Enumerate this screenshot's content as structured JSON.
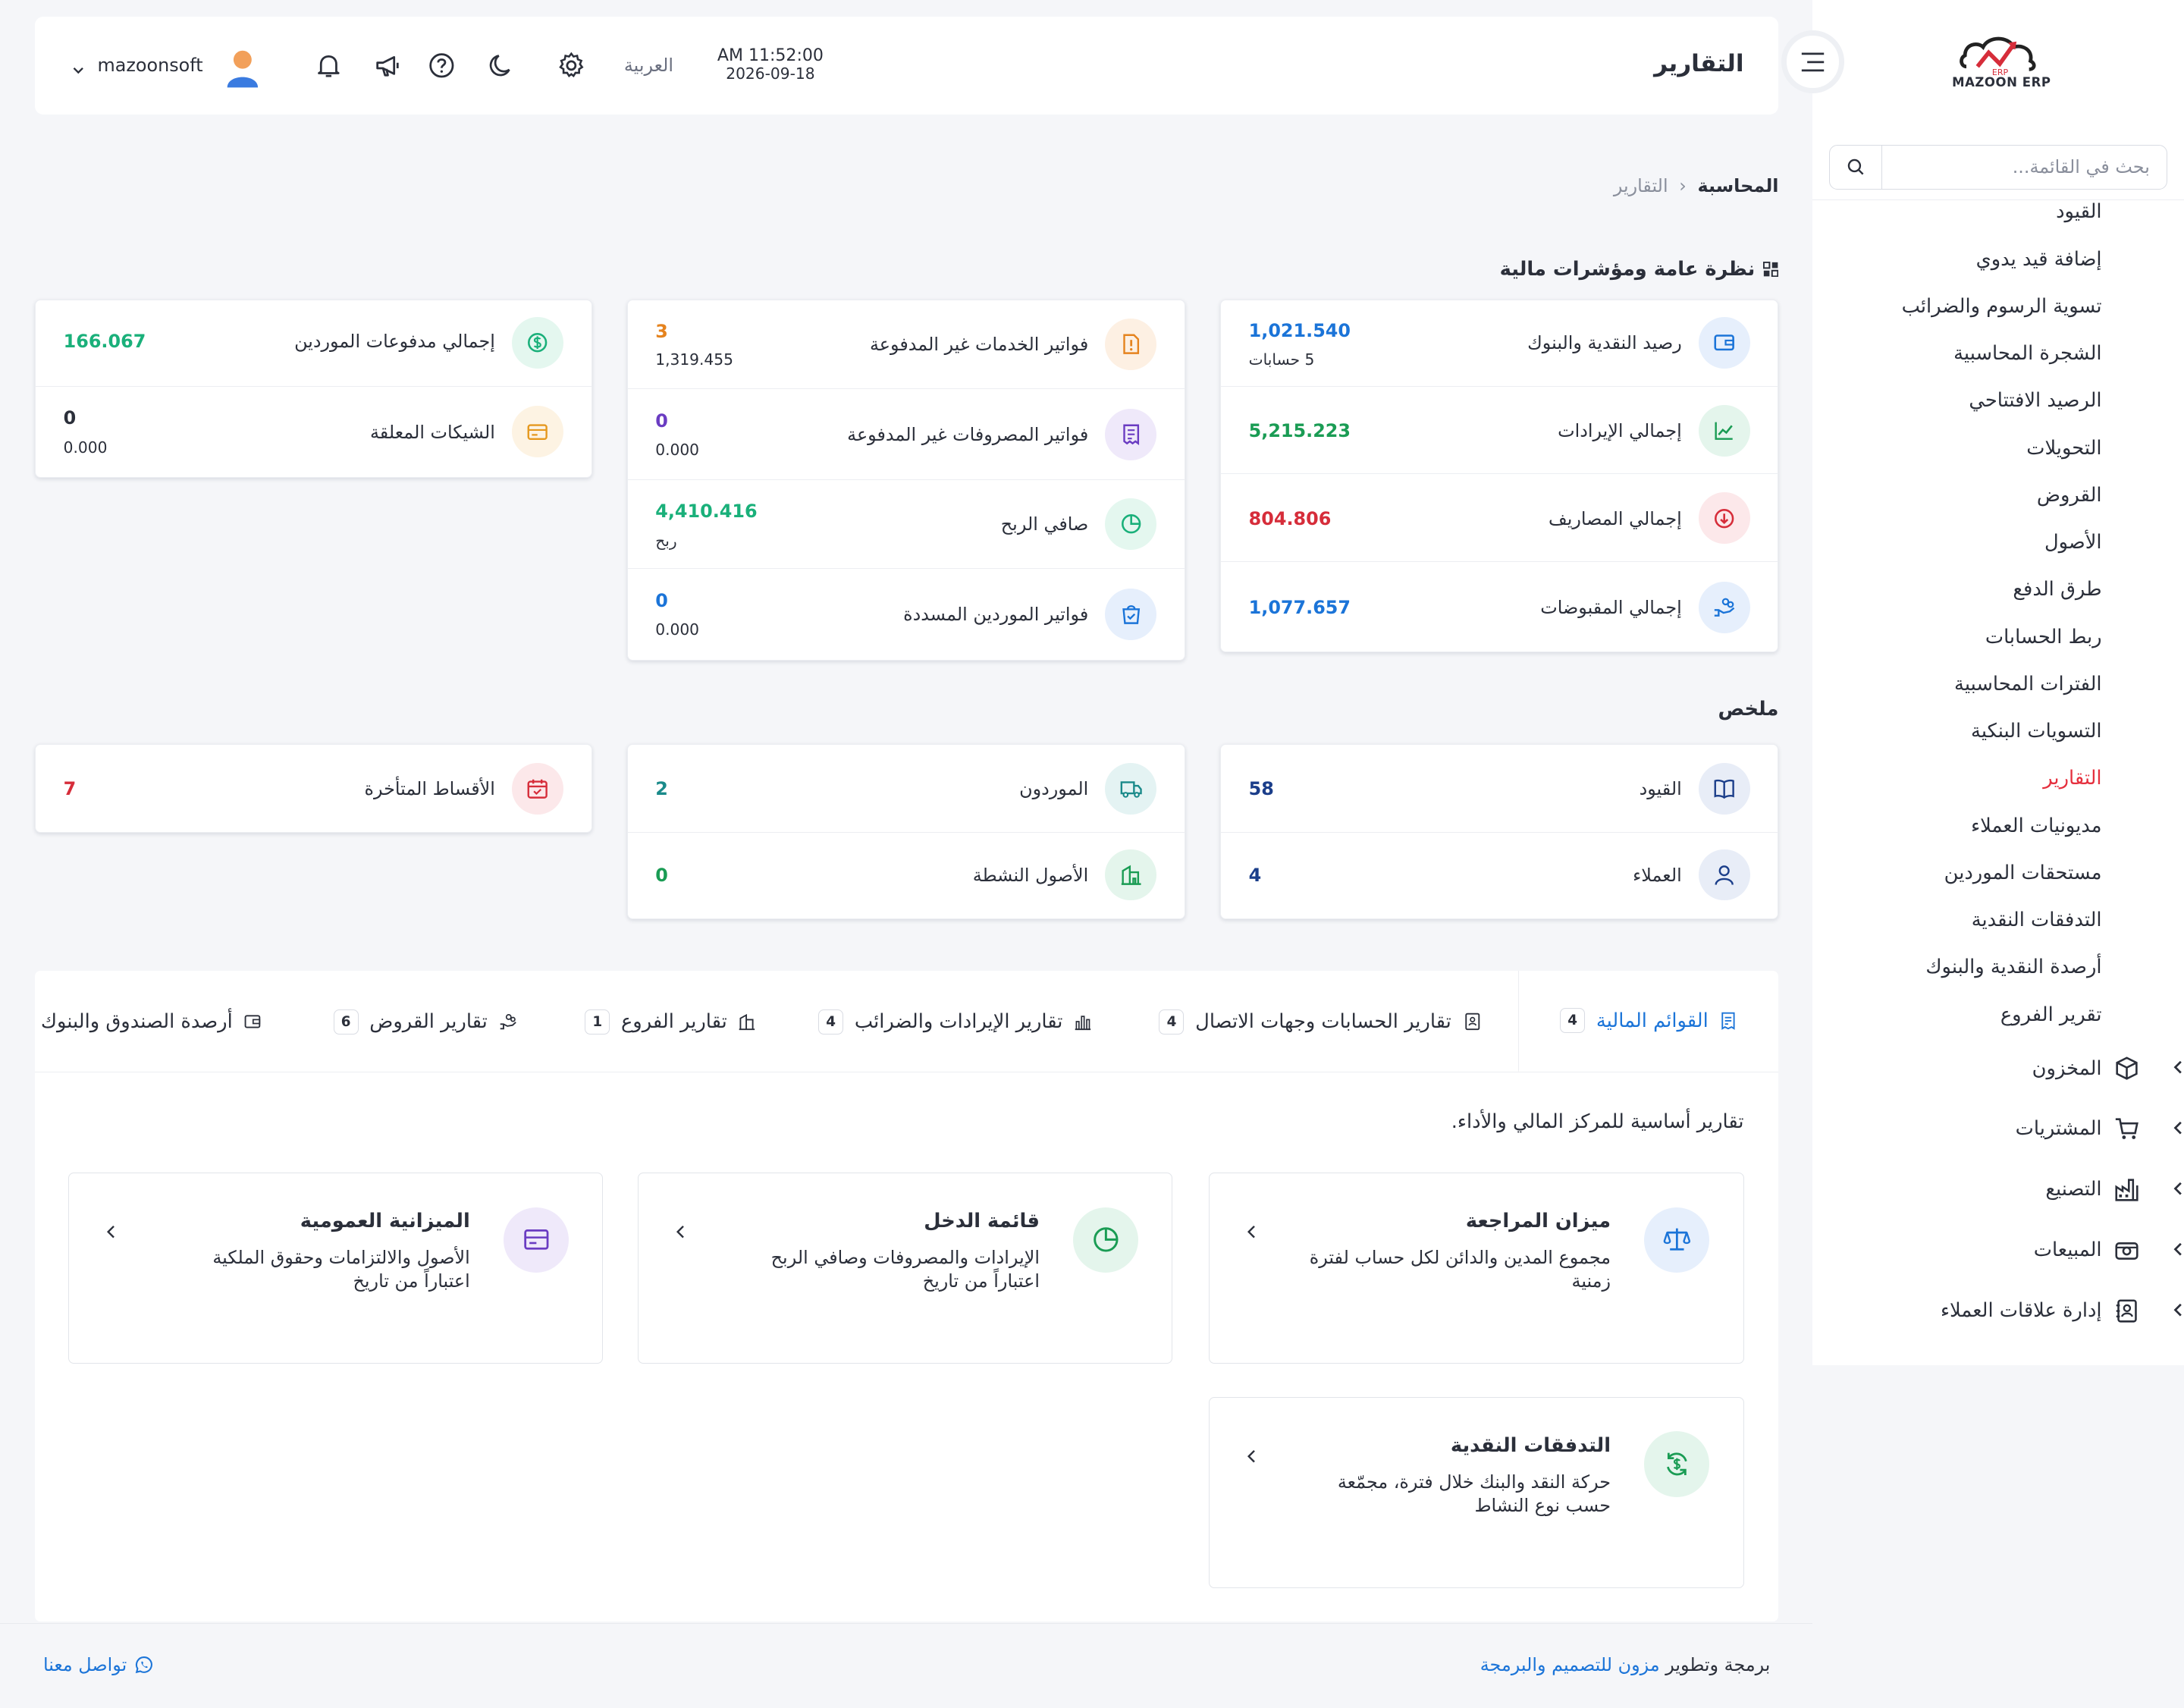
{
  "brand": {
    "name": "MAZOON ERP",
    "tag": "ERP"
  },
  "sidebar": {
    "search_placeholder": "بحث في القائمة...",
    "items": [
      {
        "label": "القيود"
      },
      {
        "label": "إضافة قيد يدوي"
      },
      {
        "label": "تسوية الرسوم والضرائب"
      },
      {
        "label": "الشجرة المحاسبية"
      },
      {
        "label": "الرصيد الافتتاحي"
      },
      {
        "label": "التحويلات"
      },
      {
        "label": "القروض"
      },
      {
        "label": "الأصول"
      },
      {
        "label": "طرق الدفع"
      },
      {
        "label": "ربط الحسابات"
      },
      {
        "label": "الفترات المحاسبية"
      },
      {
        "label": "التسويات البنكية"
      },
      {
        "label": "التقارير"
      },
      {
        "label": "مديونيات العملاء"
      },
      {
        "label": "مستحقات الموردين"
      },
      {
        "label": "التدفقات النقدية"
      },
      {
        "label": "أرصدة النقدية والبنوك"
      },
      {
        "label": "تقرير الفروع"
      }
    ],
    "groups": [
      {
        "label": "المخزون",
        "icon": "box-icon"
      },
      {
        "label": "المشتريات",
        "icon": "cart-icon"
      },
      {
        "label": "التصنيع",
        "icon": "factory-icon"
      },
      {
        "label": "المبيعات",
        "icon": "cash-register-icon"
      },
      {
        "label": "إدارة علاقات العملاء",
        "icon": "contacts-icon"
      }
    ],
    "active_color": "#e5303e"
  },
  "header": {
    "title": "التقارير",
    "time": "AM 11:52:00",
    "date": "2026-09-18",
    "language": "العربية",
    "username": "mazoonsoft"
  },
  "breadcrumb": {
    "parent": "المحاسبة",
    "current": "التقارير"
  },
  "overview": {
    "title": "نظرة عامة ومؤشرات مالية",
    "col1": [
      {
        "label": "رصيد النقدية والبنوك",
        "value": "1,021.540",
        "sub": "5 حسابات",
        "color": "#1b74d8",
        "icon": "wallet-icon"
      },
      {
        "label": "إجمالي الإيرادات",
        "value": "5,215.223",
        "color": "#1a9c54",
        "icon": "chart-line-icon"
      },
      {
        "label": "إجمالي المصاريف",
        "value": "804.806",
        "color": "#d62d3a",
        "icon": "arrow-down-circle-icon"
      },
      {
        "label": "إجمالي المقبوضات",
        "value": "1,077.657",
        "color": "#1b74d8",
        "icon": "hand-coins-icon"
      }
    ],
    "col2": [
      {
        "label": "فواتير الخدمات غير المدفوعة",
        "value": "3",
        "sub": "1,319.455",
        "color": "#e5831e",
        "icon": "invoice-alert-icon"
      },
      {
        "label": "فواتير المصروفات غير المدفوعة",
        "value": "0",
        "sub": "0.000",
        "color": "#6a3cc2",
        "icon": "receipt-icon"
      },
      {
        "label": "صافي الربح",
        "value": "4,410.416",
        "sub": "ربح",
        "color": "#1ab07a",
        "icon": "pie-icon"
      },
      {
        "label": "فواتير الموردين المسددة",
        "value": "0",
        "sub": "0.000",
        "color": "#1b74d8",
        "icon": "bag-check-icon"
      }
    ],
    "col3": [
      {
        "label": "إجمالي مدفوعات الموردين",
        "value": "166.067",
        "color": "#1ab07a",
        "icon": "dollar-circle-icon"
      },
      {
        "label": "الشيكات المعلقة",
        "value": "0",
        "sub": "0.000",
        "color": "#2b2f3a",
        "icon": "cheque-icon"
      }
    ]
  },
  "summary": {
    "title": "ملخص",
    "col1": [
      {
        "label": "القيود",
        "value": "58",
        "color": "#1b3e8a",
        "icon": "book-icon"
      },
      {
        "label": "العملاء",
        "value": "4",
        "color": "#1b3e8a",
        "icon": "user-icon"
      }
    ],
    "col2": [
      {
        "label": "الموردون",
        "value": "2",
        "color": "#1a8a8a",
        "icon": "truck-icon"
      },
      {
        "label": "الأصول النشطة",
        "value": "0",
        "color": "#1a9c54",
        "icon": "building-icon"
      }
    ],
    "col3": [
      {
        "label": "الأقساط المتأخرة",
        "value": "7",
        "color": "#d62d3a",
        "icon": "calendar-icon"
      }
    ]
  },
  "tabs": [
    {
      "label": "القوائم المالية",
      "count": "4",
      "active": true
    },
    {
      "label": "تقارير الحسابات وجهات الاتصال",
      "count": "4"
    },
    {
      "label": "تقارير الإيرادات والضرائب",
      "count": "4"
    },
    {
      "label": "تقارير الفروع",
      "count": "1"
    },
    {
      "label": "تقارير القروض",
      "count": "6"
    },
    {
      "label": "أرصدة الصندوق والبنوك",
      "count": ""
    }
  ],
  "reports": {
    "description": "تقارير أساسية للمركز المالي والأداء.",
    "items": [
      {
        "title": "ميزان المراجعة",
        "desc": "مجموع المدين والدائن لكل حساب لفترة زمنية",
        "icon": "scale-icon"
      },
      {
        "title": "قائمة الدخل",
        "desc": "الإيرادات والمصروفات وصافي الربح اعتباراً من تاريخ",
        "icon": "pie-icon"
      },
      {
        "title": "الميزانية العمومية",
        "desc": "الأصول والالتزامات وحقوق الملكية اعتباراً من تاريخ",
        "icon": "card-icon"
      },
      {
        "title": "التدفقات النقدية",
        "desc": "حركة النقد والبنك خلال فترة، مجمّعة حسب نوع النشاط",
        "icon": "cash-cycle-icon"
      }
    ]
  },
  "footer": {
    "credit_prefix": "برمجة وتطوير",
    "credit_link": "مزون للتصميم والبرمجة",
    "contact": "تواصل معنا"
  }
}
